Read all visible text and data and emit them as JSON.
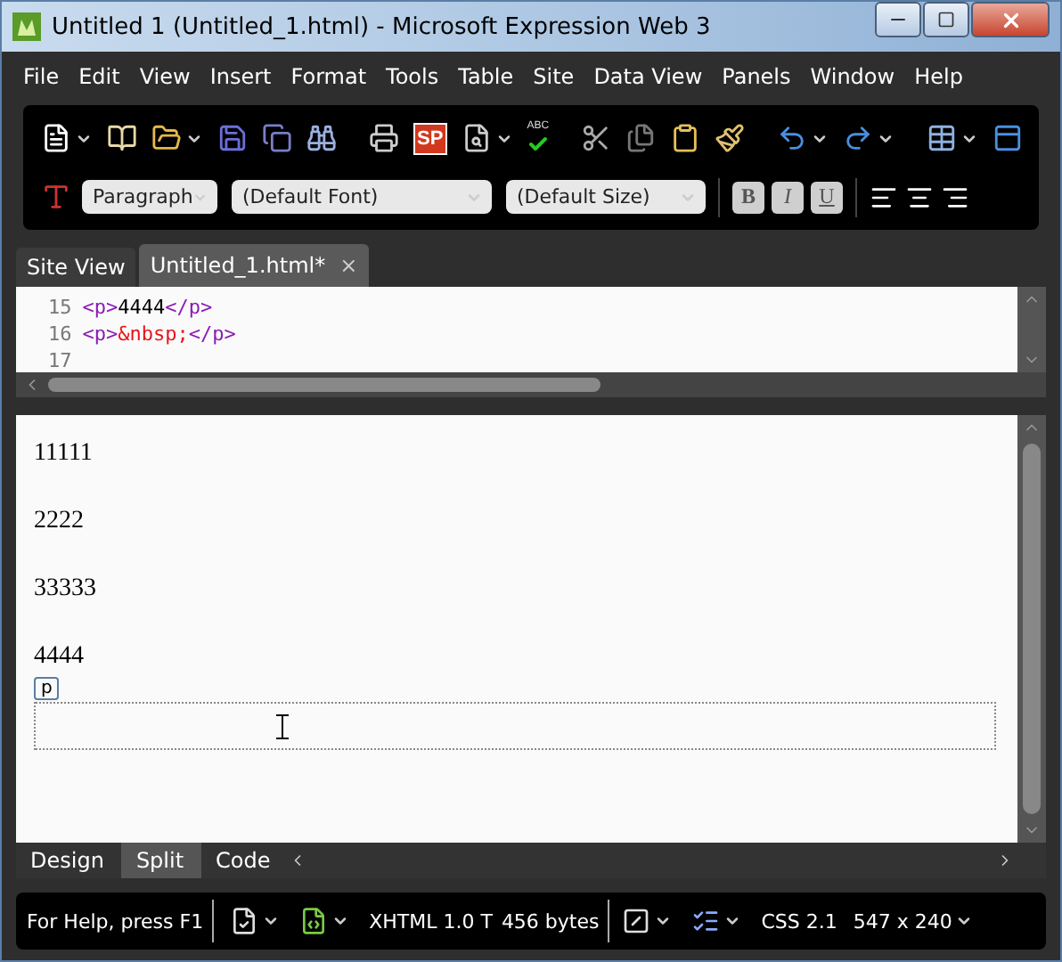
{
  "window": {
    "title": "Untitled 1 (Untitled_1.html) - Microsoft Expression Web 3"
  },
  "menu": [
    "File",
    "Edit",
    "View",
    "Insert",
    "Format",
    "Tools",
    "Table",
    "Site",
    "Data View",
    "Panels",
    "Window",
    "Help"
  ],
  "toolbar": {
    "row1": [
      {
        "kind": "icon",
        "dropdown": true
      },
      {
        "kind": "icon",
        "dropdown": false
      },
      {
        "kind": "icon",
        "dropdown": true
      },
      {
        "kind": "icon",
        "dropdown": false
      },
      {
        "kind": "icon",
        "dropdown": false
      },
      {
        "kind": "icon",
        "dropdown": false
      },
      {
        "kind": "sep"
      },
      {
        "kind": "icon",
        "dropdown": false
      },
      {
        "kind": "logo",
        "label": "SP",
        "dropdown": false
      },
      {
        "kind": "icon",
        "dropdown": true
      },
      {
        "kind": "spell",
        "label": "ABC",
        "dropdown": false
      },
      {
        "kind": "sep"
      },
      {
        "kind": "icon",
        "dropdown": false
      },
      {
        "kind": "icon",
        "dropdown": false
      },
      {
        "kind": "icon",
        "dropdown": false
      },
      {
        "kind": "icon",
        "dropdown": false
      },
      {
        "kind": "sep"
      },
      {
        "kind": "icon",
        "dropdown": true
      },
      {
        "kind": "icon",
        "dropdown": true
      },
      {
        "kind": "sep"
      },
      {
        "kind": "icon",
        "dropdown": true
      },
      {
        "kind": "icon",
        "dropdown": false
      }
    ],
    "style": "Paragraph",
    "font": "(Default Font)",
    "size": "(Default Size)",
    "format_buttons": [
      "B",
      "I",
      "U"
    ]
  },
  "tabs": [
    {
      "label": "Site View",
      "selected": false,
      "closable": false
    },
    {
      "label": "Untitled_1.html*",
      "selected": true,
      "closable": true,
      "close": "×"
    }
  ],
  "code_lines": [
    {
      "number": "15",
      "parts": [
        {
          "kind": "tag",
          "text": "<p>"
        },
        {
          "kind": "text",
          "text": "4444"
        },
        {
          "kind": "tag",
          "text": "</p>"
        }
      ]
    },
    {
      "number": "16",
      "parts": [
        {
          "kind": "tag",
          "text": "<p>"
        },
        {
          "kind": "entity",
          "text": "&nbsp;"
        },
        {
          "kind": "tag",
          "text": "</p>"
        }
      ]
    },
    {
      "number": "17"
    }
  ],
  "design": {
    "paragraphs": [
      "11111",
      "2222",
      "33333",
      "4444"
    ],
    "tag_label": "p"
  },
  "view_tabs": [
    {
      "label": "Design",
      "selected": false
    },
    {
      "label": "Split",
      "selected": true
    },
    {
      "label": "Code",
      "selected": false
    }
  ],
  "status_bar": {
    "help": "For Help, press F1",
    "doctype": "XHTML 1.0 T",
    "size": "456 bytes",
    "css": "CSS 2.1",
    "dimensions": "547 x 240"
  }
}
